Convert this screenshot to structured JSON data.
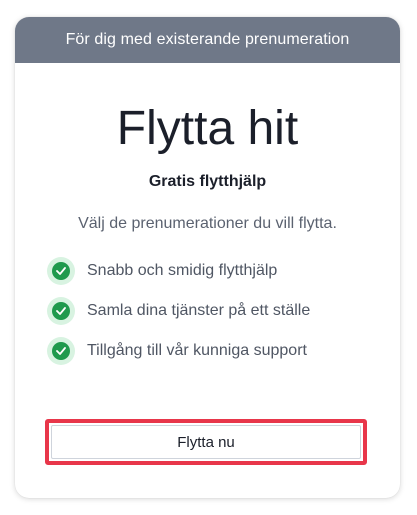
{
  "header": {
    "banner": "För dig med existerande prenumeration"
  },
  "main": {
    "title": "Flytta hit",
    "subtitle": "Gratis flytthjälp",
    "description": "Välj de prenumerationer du vill flytta.",
    "features": [
      {
        "label": "Snabb och smidig flytthjälp",
        "icon": "check-icon"
      },
      {
        "label": "Samla dina tjänster på ett ställe",
        "icon": "check-icon"
      },
      {
        "label": "Tillgång till vår kunniga support",
        "icon": "check-icon"
      }
    ],
    "cta_label": "Flytta nu"
  },
  "colors": {
    "header_bg": "#6f7888",
    "check_green": "#1f9a4d",
    "check_bg": "#d8f3e1",
    "highlight_red": "#e8364a"
  }
}
